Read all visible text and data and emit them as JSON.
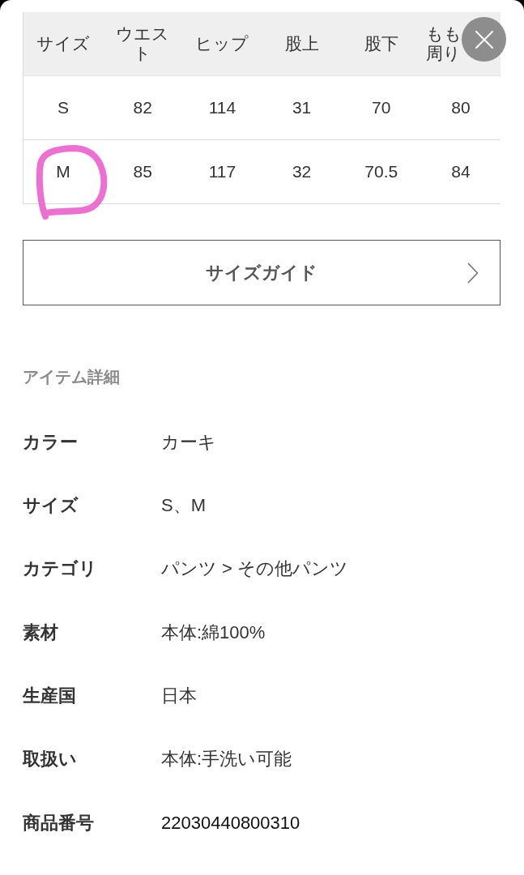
{
  "size_table": {
    "columns": [
      "サイズ",
      "ウエスト",
      "ヒップ",
      "股上",
      "股下",
      "もも周り"
    ],
    "rows": [
      {
        "cells": [
          "S",
          "82",
          "114",
          "31",
          "70",
          "80"
        ],
        "circled": false
      },
      {
        "cells": [
          "M",
          "85",
          "117",
          "32",
          "70.5",
          "84"
        ],
        "circled": true
      }
    ]
  },
  "size_guide_button": {
    "label": "サイズガイド"
  },
  "item_details": {
    "title": "アイテム詳細",
    "rows": [
      {
        "label": "カラー",
        "value": "カーキ",
        "emphasized": false
      },
      {
        "label": "サイズ",
        "value": "S、M",
        "emphasized": false
      },
      {
        "label": "カテゴリ",
        "value": "パンツ > その他パンツ",
        "emphasized": false
      },
      {
        "label": "素材",
        "value": "本体:綿100%",
        "emphasized": false
      },
      {
        "label": "生産国",
        "value": "日本",
        "emphasized": false
      },
      {
        "label": "取扱い",
        "value": "本体:手洗い可能",
        "emphasized": false
      },
      {
        "label": "商品番号",
        "value": "22030440800310",
        "emphasized": true
      }
    ]
  }
}
